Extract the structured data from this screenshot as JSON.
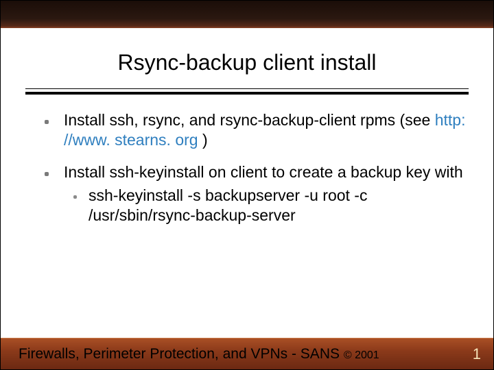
{
  "slide": {
    "title": "Rsync-backup client install",
    "bullets": [
      {
        "text_pre": "Install ssh, rsync, and rsync-backup-client rpms (see ",
        "link": "http: //www. stearns. org",
        "text_post": " )"
      },
      {
        "text": "Install ssh-keyinstall on client to create a backup key with",
        "sub": "ssh-keyinstall -s backupserver -u root -c /usr/sbin/rsync-backup-server"
      }
    ]
  },
  "footer": {
    "text": "Firewalls, Perimeter Protection, and VPNs - SANS ",
    "copyright": "© 2001",
    "page": "1"
  }
}
